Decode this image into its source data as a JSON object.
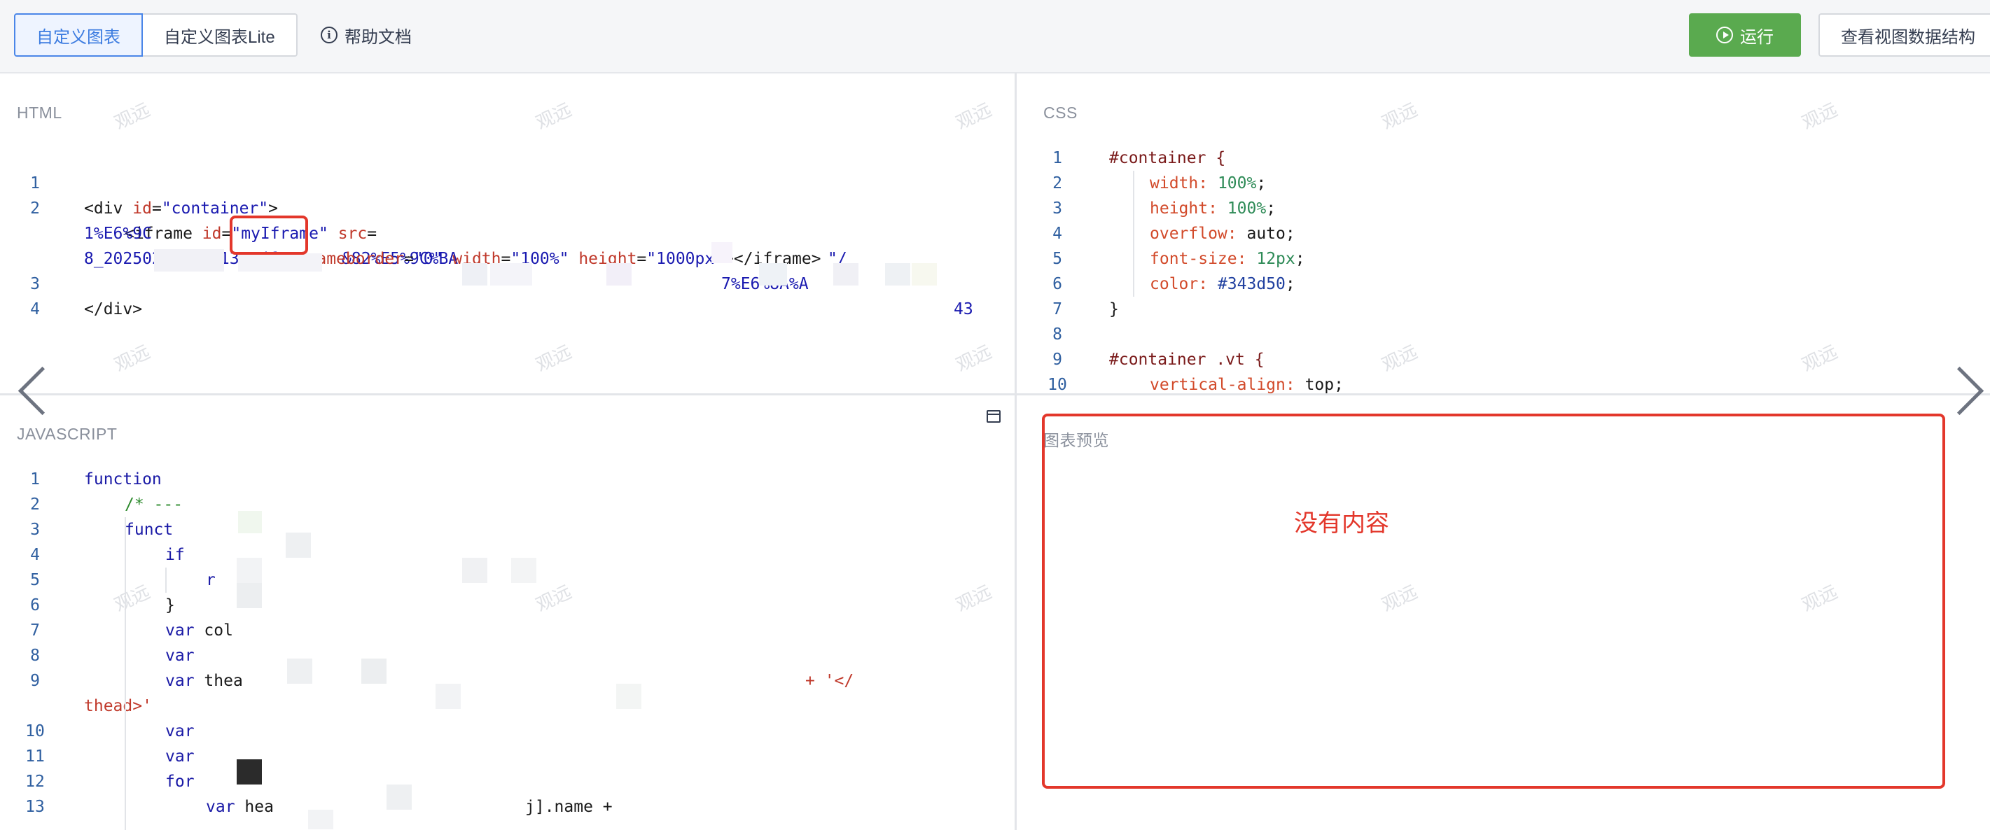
{
  "toolbar": {
    "tabs": [
      {
        "label": "自定义图表",
        "active": true
      },
      {
        "label": "自定义图表Lite",
        "active": false
      }
    ],
    "help_label": "帮助文档",
    "run_label": "运行",
    "view_structure_label": "查看视图数据结构"
  },
  "html_panel": {
    "title": "HTML",
    "line_numbers": [
      "1",
      "2",
      "3",
      "4"
    ],
    "lines": {
      "l1": {
        "open": "<div ",
        "attr": "id",
        "eq": "=",
        "val": "\"container\"",
        "close": ">"
      },
      "l2a": {
        "open": "<iframe ",
        "attr1": "id",
        "val1": "\"myIframe\"",
        "attr2": "src",
        "eq": "=",
        "frag": "\"/"
      },
      "l2b": {
        "p1": "1%E6%9C",
        "p2": "&82%E5%9C%BA",
        "p3": "7%E6%8A%A",
        "p4": "43"
      },
      "l2c": {
        "p1": "8_2025021314011",
        "p2": "3.pdf\"",
        "attr1": "frameborder",
        "val1": "\"0\"",
        "attr2": "width",
        "val2": "\"100%\"",
        "attr3": "height",
        "val3": "\"1000px\"",
        "close": "></iframe>"
      },
      "l3": "</div>"
    }
  },
  "css_panel": {
    "title": "CSS",
    "line_numbers": [
      "1",
      "2",
      "3",
      "4",
      "5",
      "6",
      "7",
      "8",
      "9",
      "10"
    ],
    "lines": {
      "l1": "#container {",
      "l2": {
        "prop": "width:",
        "val": "100%",
        "end": ";"
      },
      "l3": {
        "prop": "height:",
        "val": "100%",
        "end": ";"
      },
      "l4": {
        "prop": "overflow:",
        "val": "auto;"
      },
      "l5": {
        "prop": "font-size:",
        "val": "12px",
        "end": ";"
      },
      "l6": {
        "prop": "color:",
        "val": "#343d50",
        "end": ";"
      },
      "l7": "}",
      "l9": "#container .vt {",
      "l10": {
        "prop": "vertical-align:",
        "val": "top;"
      }
    }
  },
  "js_panel": {
    "title": "JAVASCRIPT",
    "line_numbers": [
      "1",
      "2",
      "3",
      "4",
      "5",
      "6",
      "7",
      "8",
      "9",
      "10",
      "11",
      "12",
      "13"
    ],
    "lines": {
      "l1": "function",
      "l2": "/* ---",
      "l3": "funct",
      "l4": "if",
      "l5": "r",
      "l6": "}",
      "l7": {
        "kw": "var",
        "rest": "col"
      },
      "l8": {
        "kw": "var",
        "rest": ""
      },
      "l9": {
        "kw": "var",
        "rest": "thea",
        "tail": "+ '</"
      },
      "l9b": "thead>'",
      "l10": "var",
      "l11": "var",
      "l12": "for",
      "l13": {
        "kw": "var",
        "rest": "hea",
        "tail": "j].name +"
      }
    }
  },
  "preview_panel": {
    "title": "图表预览",
    "empty_text": "没有内容"
  },
  "watermark_text": "观远",
  "colors": {
    "accent_blue": "#3b7be0",
    "run_green": "#5aaa4f",
    "annotation_red": "#e3372b",
    "text": "#343d50"
  },
  "icons": {
    "help": "info-circle-icon",
    "run": "play-circle-icon",
    "expand": "window-maximize-icon",
    "prev": "chevron-left-icon",
    "next": "chevron-right-icon"
  }
}
